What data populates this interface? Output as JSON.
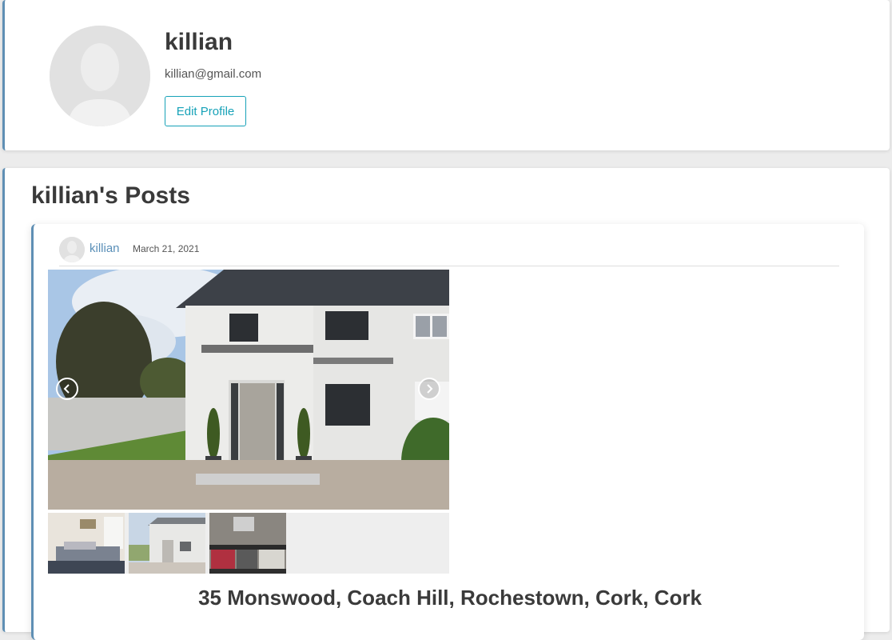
{
  "profile": {
    "name": "killian",
    "email": "killian@gmail.com",
    "edit_label": "Edit Profile",
    "avatar_icon": "default-user-silhouette-icon"
  },
  "posts_section": {
    "title": "killian's Posts"
  },
  "post": {
    "author": "killian",
    "date": "March 21, 2021",
    "address": "35 Monswood, Coach Hill, Rochestown, Cork, Cork",
    "carousel": {
      "prev_icon": "chevron-left-icon",
      "next_icon": "chevron-right-icon",
      "main_image": "house-exterior-photo",
      "thumbnails": [
        "bedroom-photo",
        "house-exterior-photo",
        "kitchen-photo"
      ]
    }
  },
  "colors": {
    "accent": "#5f8fb4",
    "button": "#17a2b8",
    "link": "#5a8fb8",
    "background": "#ececec"
  }
}
